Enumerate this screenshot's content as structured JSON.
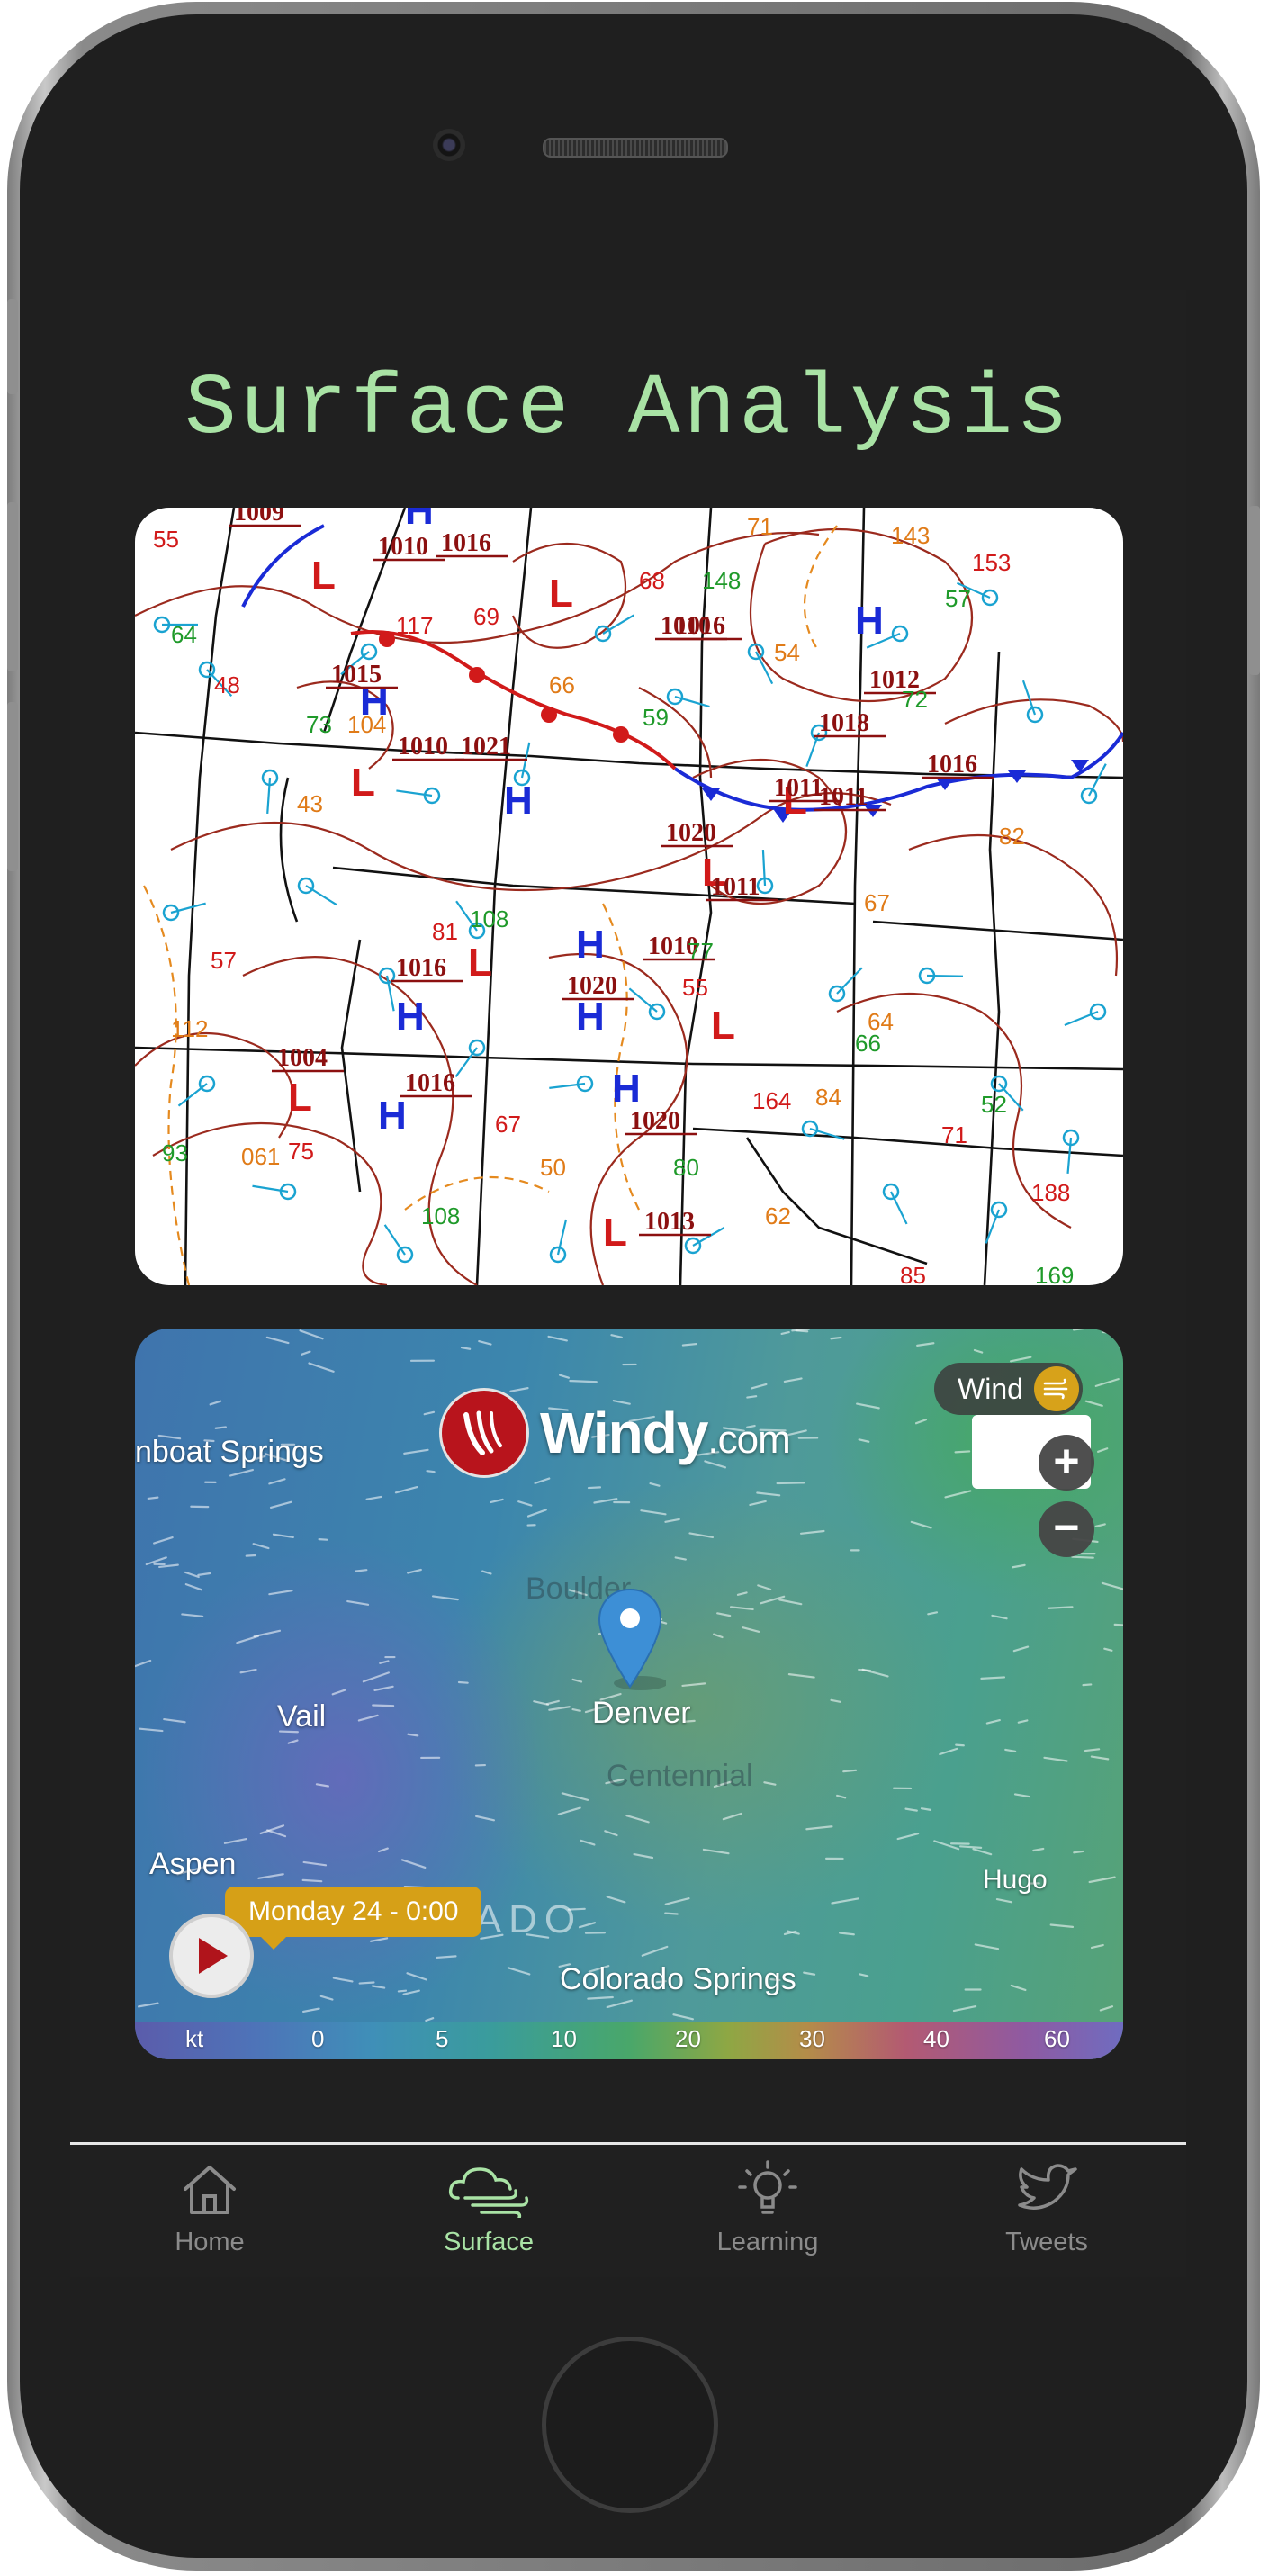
{
  "app": {
    "title": "Surface Analysis"
  },
  "surface_map": {
    "pressure_labels": [
      "1009",
      "1016",
      "1010",
      "1015",
      "1010",
      "1021",
      "1020",
      "1020",
      "1016",
      "1010",
      "1004",
      "1016",
      "1020",
      "1013",
      "1011",
      "1011",
      "1011",
      "1016",
      "1018",
      "1010",
      "1012",
      "1016"
    ],
    "station_values": [
      "55",
      "64",
      "71",
      "68",
      "148",
      "143",
      "153",
      "57",
      "54",
      "69",
      "73",
      "104",
      "117",
      "59",
      "66",
      "48",
      "72",
      "43",
      "81",
      "108",
      "67",
      "55",
      "77",
      "112",
      "57",
      "93",
      "061",
      "75",
      "108",
      "50",
      "67",
      "80",
      "62",
      "85",
      "169",
      "82",
      "188",
      "52",
      "84",
      "164",
      "66",
      "64",
      "71"
    ]
  },
  "windy": {
    "logo_word": "Windy",
    "logo_suffix": ".com",
    "layer_label": "Wind",
    "layer_icon": "wind-layer-icon",
    "zoom_in_label": "+",
    "zoom_out_label": "−",
    "marker_city": "Denver",
    "cities": {
      "steamboat": "nboat Springs",
      "vail": "Vail",
      "aspen": "Aspen",
      "hugo": "Hugo",
      "colorado_springs": "Colorado Springs",
      "boulder": "Boulder",
      "centennial": "Centennial"
    },
    "state_label": "RADO",
    "timestamp": "Monday 24 - 0:00",
    "scale": {
      "unit": "kt",
      "ticks": [
        "0",
        "5",
        "10",
        "20",
        "30",
        "40",
        "60"
      ]
    }
  },
  "tabs": [
    {
      "label": "Home",
      "icon": "home-icon",
      "active": false
    },
    {
      "label": "Surface",
      "icon": "wind-cloud-icon",
      "active": true
    },
    {
      "label": "Learning",
      "icon": "lightbulb-icon",
      "active": false
    },
    {
      "label": "Tweets",
      "icon": "twitter-bird-icon",
      "active": false
    }
  ],
  "colors": {
    "accent": "#a9e3a5",
    "screen_bg": "#202020",
    "windy_red": "#b8141c",
    "timestamp_bg": "#d6a017"
  }
}
